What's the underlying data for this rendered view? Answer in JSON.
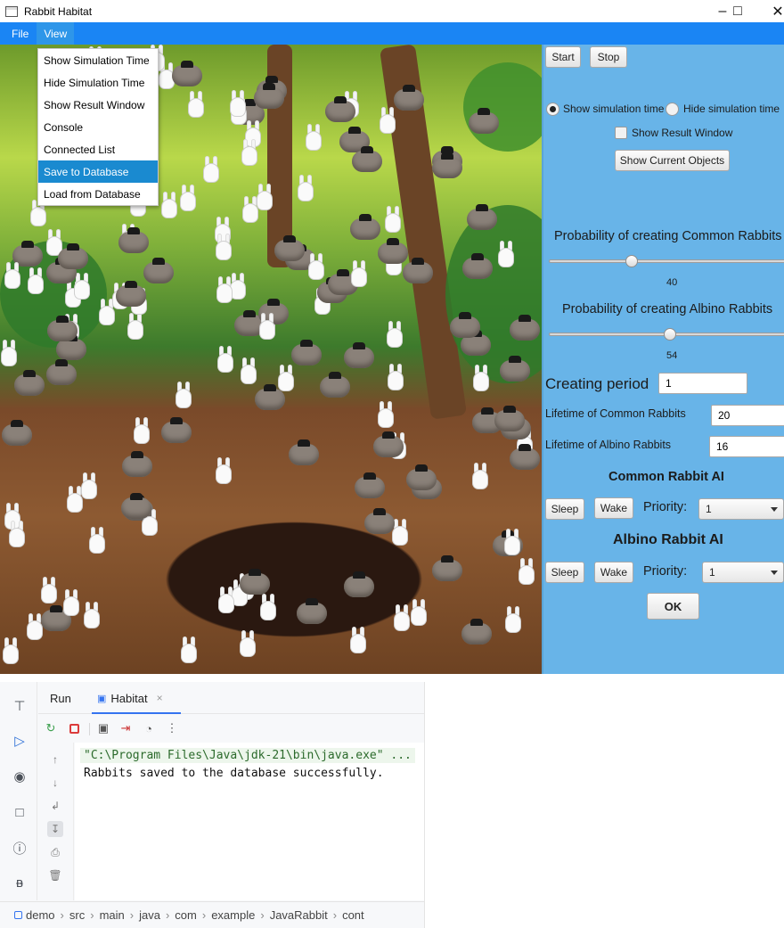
{
  "window": {
    "title": "Rabbit Habitat",
    "minimize_icon": "minimize-icon",
    "maximize_icon": "maximize-icon",
    "close_icon": "close-icon"
  },
  "menubar": {
    "file": "File",
    "view": "View",
    "accent": "#1a85f4"
  },
  "view_menu": {
    "items": [
      "Show Simulation Time",
      "Hide Simulation Time",
      "Show Result Window",
      "Console",
      "Connected List",
      "Save to Database",
      "Load from Database"
    ],
    "highlighted": "Save to Database"
  },
  "controls": {
    "start": "Start",
    "stop": "Stop",
    "show_time": "Show simulation time",
    "hide_time": "Hide simulation time",
    "time_selected": "Show simulation time",
    "show_result_window": "Show Result Window",
    "show_result_checked": false,
    "show_current_objects": "Show Current Objects",
    "common_prob_label": "Probability of creating Common Rabbits",
    "common_prob_value": "40",
    "albino_prob_label": "Probability of creating Albino Rabbits",
    "albino_prob_value": "54",
    "period_label": "Creating period",
    "period_value": "1",
    "common_lifetime_label": "Lifetime of Common Rabbits",
    "common_lifetime_value": "20",
    "albino_lifetime_label": "Lifetime of Albino Rabbits",
    "albino_lifetime_value": "16",
    "common_ai_title": "Common Rabbit AI",
    "albino_ai_title": "Albino Rabbit AI",
    "sleep": "Sleep",
    "wake": "Wake",
    "priority_label": "Priority:",
    "common_priority": "1",
    "albino_priority": "1",
    "ok": "OK",
    "panel_color": "#68b4e8"
  },
  "ide": {
    "run_tab": "Run",
    "habitat_tab": "Habitat",
    "console_lines": [
      "\"C:\\Program Files\\Java\\jdk-21\\bin\\java.exe\" ...",
      "Rabbits saved to the database successfully."
    ],
    "breadcrumb": [
      "demo",
      "src",
      "main",
      "java",
      "com",
      "example",
      "JavaRabbit",
      "cont"
    ]
  }
}
